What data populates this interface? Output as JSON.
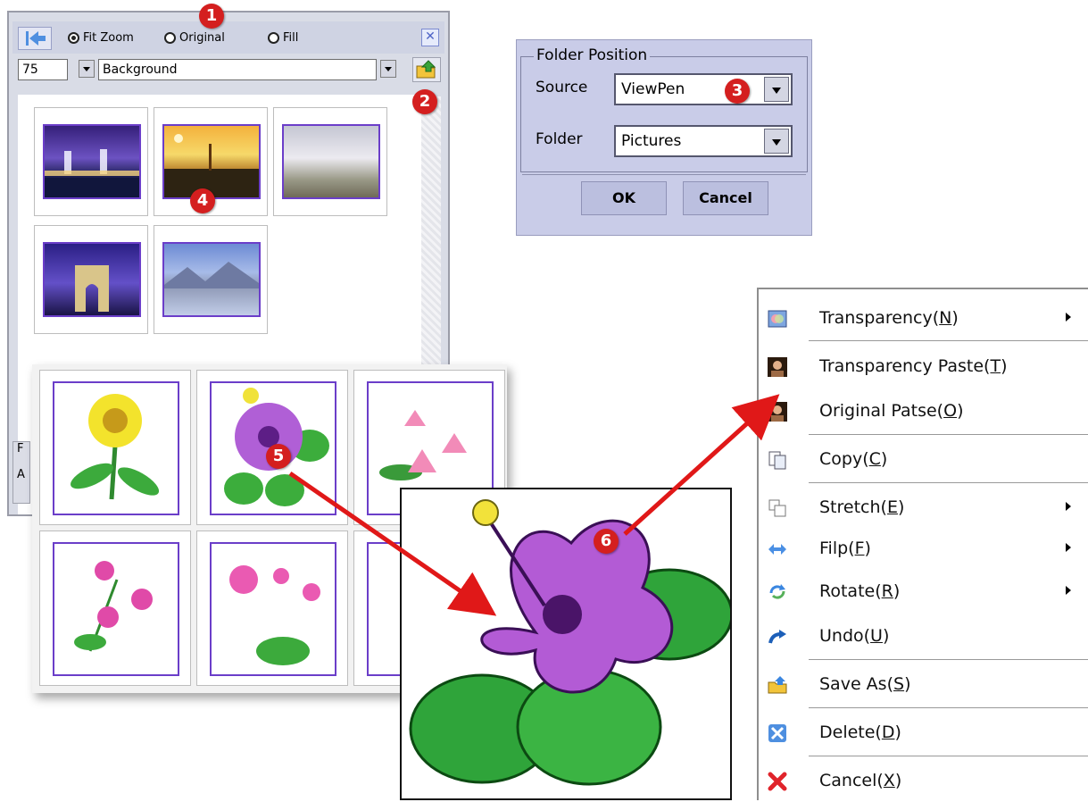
{
  "browser": {
    "view_modes": [
      {
        "label": "Fit Zoom",
        "selected": true
      },
      {
        "label": "Original",
        "selected": false
      },
      {
        "label": "Fill",
        "selected": false
      }
    ],
    "zoom_value": "75",
    "category_value": "Background",
    "status_lines": [
      "F",
      "A"
    ]
  },
  "dialog": {
    "title": "Folder Position",
    "source_label": "Source",
    "source_value": "ViewPen",
    "folder_label": "Folder",
    "folder_value": "Pictures",
    "ok_label": "OK",
    "cancel_label": "Cancel"
  },
  "menu": {
    "items": [
      {
        "text": "Transparency(",
        "key": "N",
        "icon": "transparency-icon",
        "submenu": true
      },
      {
        "text": "Transparency Paste(",
        "key": "T",
        "icon": "portrait-icon",
        "submenu": false
      },
      {
        "text": "Original Patse(",
        "key": "O",
        "icon": "portrait-icon",
        "submenu": false
      },
      {
        "text": "Copy(",
        "key": "C",
        "icon": "copy-icon",
        "submenu": false
      },
      {
        "text": "Stretch(",
        "key": "E",
        "icon": "stretch-icon",
        "submenu": true
      },
      {
        "text": "Filp(",
        "key": "F",
        "icon": "flip-icon",
        "submenu": true
      },
      {
        "text": "Rotate(",
        "key": "R",
        "icon": "rotate-icon",
        "submenu": true
      },
      {
        "text": "Undo(",
        "key": "U",
        "icon": "undo-icon",
        "submenu": false
      },
      {
        "text": "Save As(",
        "key": "S",
        "icon": "folder-save-icon",
        "submenu": false
      },
      {
        "text": "Delete(",
        "key": "D",
        "icon": "delete-icon",
        "submenu": false
      },
      {
        "text": "Cancel(",
        "key": "X",
        "icon": "cancel-icon",
        "submenu": false
      }
    ],
    "close_paren": ")"
  },
  "badges": [
    "1",
    "2",
    "3",
    "4",
    "5",
    "6"
  ],
  "colors": {
    "badge": "#d41f1f",
    "dialog_bg": "#c9cce8",
    "panel_bg": "#d9dce6",
    "frame": "#6b3ec9",
    "arrow": "#e01818"
  }
}
